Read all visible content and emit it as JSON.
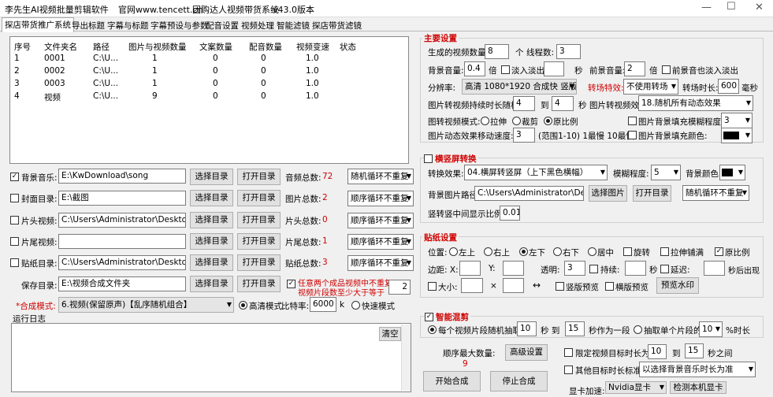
{
  "window": {
    "title": "李先生AI视频批量剪辑软件",
    "site": "官网www.tencett.cn",
    "slogan": "团购达人视频带货系统",
    "version": "v43.0版本"
  },
  "tabs": [
    "探店带货推广系统",
    "导出标题",
    "字幕与标题",
    "字幕预设与参数",
    "配音设置",
    "视频处理",
    "智能滤镜",
    "探店带货滤镜"
  ],
  "grid": {
    "headers": [
      "序号",
      "文件夹名",
      "路径",
      "图片与视频数量",
      "文案数量",
      "配音数量",
      "视频变速",
      "状态"
    ],
    "rows": [
      [
        "1",
        "0001",
        "C:\\U...",
        "1",
        "0",
        "0",
        "1.0",
        ""
      ],
      [
        "2",
        "0002",
        "C:\\U...",
        "1",
        "0",
        "0",
        "1.0",
        ""
      ],
      [
        "3",
        "0003",
        "C:\\U...",
        "1",
        "0",
        "0",
        "1.0",
        ""
      ],
      [
        "4",
        "视频",
        "C:\\U...",
        "9",
        "0",
        "0",
        "1.0",
        ""
      ]
    ]
  },
  "left": {
    "music": {
      "label": "背景音乐:",
      "path": "E:\\KwDownload\\song",
      "count_label": "音频总数:",
      "count": "72",
      "mode": "随机循环不重复"
    },
    "cover": {
      "label": "封面目录:",
      "path": "E:\\截图",
      "count_label": "图片总数:",
      "count": "2",
      "mode": "顺序循环不重复"
    },
    "intro": {
      "label": "片头视频:",
      "path": "C:\\Users\\Administrator\\Desktop\\新",
      "count_label": "片头总数:",
      "count": "0",
      "mode": "顺序循环不重复"
    },
    "outro": {
      "label": "片尾视频:",
      "path": "",
      "count_label": "片尾总数:",
      "count": "1",
      "mode": "顺序循环不重复"
    },
    "sticker": {
      "label": "贴纸目录:",
      "path": "C:\\Users\\Administrator\\Desktop\\滴",
      "count_label": "贴纸总数:",
      "count": "3",
      "mode": "顺序循环不重复"
    },
    "save": {
      "label": "保存目录:",
      "path": "E:\\视频合成文件夹"
    },
    "select_dir": "选择目录",
    "open_dir": "打开目录",
    "notice_line1": "任意两个成品视频中不重复",
    "notice_line2": "视频片段数至少大于等于",
    "notice_value": "2",
    "mode_label": "*合成模式:",
    "mode_value": "6.视频(保留原声)【乱序随机组合】",
    "hd_label": "高清模式",
    "bitrate_label": "比特率:",
    "bitrate": "6000",
    "bitrate_unit": "k",
    "fast_label": "快速模式",
    "reencode_label": "重编码合成(在视频蜕变导致花屏时勾选)",
    "log_label": "运行日志",
    "clear": "清空"
  },
  "right": {
    "main_title": "主要设置",
    "gen_count_label": "生成的视频数量:",
    "gen_count": "8",
    "gen_unit": "个",
    "threads_label": "线程数:",
    "threads": "3",
    "bgvol_label": "背景音量:",
    "bgvol": "0.4",
    "bgvol_unit": "倍",
    "fade_label": "淡入淡出",
    "fade_unit": "秒",
    "fgvol_label": "前景音量:",
    "fgvol": "2",
    "fgvol_unit": "倍",
    "fgfade_label": "前景音也淡入淡出",
    "res_label": "分辨率:",
    "res": "高清 1080*1920 合成快 竖版",
    "trans_label": "转场特效:",
    "trans": "不使用转场",
    "trans_dur_label": "转场时长:",
    "trans_dur": "600",
    "trans_unit": "毫秒",
    "img_dur_label": "图片转视频持续时长随机:",
    "img_dur_min": "4",
    "img_dur_to": "到",
    "img_dur_max": "4",
    "img_dur_unit": "秒",
    "img_effect_label": "图片转视频效果:",
    "img_effect": "18.随机所有动态效果",
    "img_mode_label": "图转视频模式:",
    "stretch": "拉伸",
    "crop": "裁剪",
    "orig": "原比例",
    "blur_fill_label": "图片背景填充模糊程度:",
    "blur_fill": "3",
    "move_speed_label": "图片动态效果移动速度:",
    "move_speed": "3",
    "move_hint": "(范围1-10) 1最慢 10最快",
    "color_fill_label": "图片背景填充颜色:",
    "h2v_title": "横竖屏转换",
    "h2v_effect_label": "转换效果:",
    "h2v_effect": "04.横屏转竖屏（上下黑色横幅）",
    "blur_label": "模糊程度:",
    "blur": "5",
    "bgcolor_label": "背景颜色:",
    "bgimg_label": "背景图片路径:",
    "bgimg": "C:\\Users\\Administrator\\Deskto",
    "select_img": "选择图片",
    "open_dir": "打开目录",
    "bgimg_mode": "随机循环不重复",
    "h2v_ratio_label": "竖转竖中间显示比例:",
    "h2v_ratio": "0.01",
    "sticker_title": "贴纸设置",
    "pos_label": "位置:",
    "pos": [
      "左上",
      "右上",
      "左下",
      "右下",
      "居中"
    ],
    "rotate": "旋转",
    "stretch_fill": "拉伸铺满",
    "keep_ratio": "原比例",
    "margin_label": "边距: X:",
    "y_label": "Y:",
    "alpha_label": "透明:",
    "alpha": "3",
    "dur_label": "持续:",
    "dur_unit": "秒",
    "delay_label": "延迟:",
    "delay_after": "秒后出现",
    "size_label": "大小:",
    "times": "×",
    "swap": "↔",
    "portrait_preview": "竖版预览",
    "landscape_preview": "横版预览",
    "preset_wm": "预览水印",
    "smart_title": "智能混剪",
    "per_clip_label": "每个视频片段随机抽取",
    "clip_min": "10",
    "clip_to": "秒 到",
    "clip_max": "15",
    "clip_unit": "秒作为一段",
    "single_label": "抽取单个片段的",
    "single_val": "10",
    "single_unit": "%时长",
    "max_label": "顺序最大数量:",
    "max_val": "9",
    "adv_btn": "高级设置",
    "limit_label": "限定视频目标时长为:",
    "limit_min": "10",
    "limit_to": "到",
    "limit_max": "15",
    "limit_unit": "秒之间",
    "other_label": "其他目标时长标准:",
    "other_val": "以选择背景音乐时长为准",
    "start_btn": "开始合成",
    "stop_btn": "停止合成",
    "hw_label": "显卡加速:",
    "hw_val": "Nvidia显卡",
    "detect_btn": "检测本机显卡"
  }
}
